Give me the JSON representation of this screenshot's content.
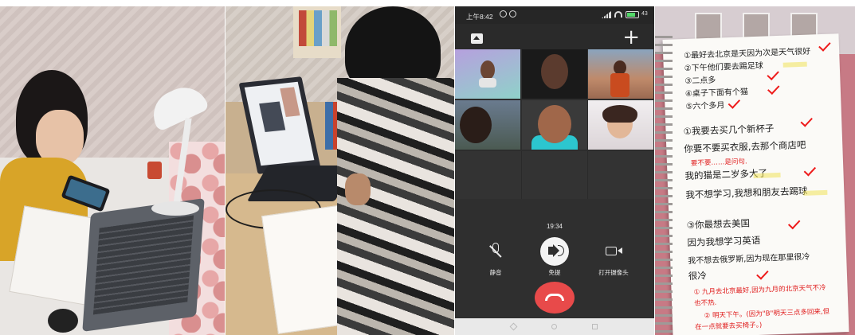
{
  "video_call": {
    "status_bar": {
      "time": "上午8:42",
      "battery": "43"
    },
    "add_label": "+",
    "duration": "19:34",
    "controls": {
      "mute_label": "静音",
      "speaker_label": "免提",
      "camera_label": "打开摄像头"
    },
    "participant_count": 6
  },
  "notebook": {
    "lines": [
      "①最好去北京是天因为次是天气很好",
      "②下午他们要去踢足球",
      "③二点多",
      "④桌子下面有个猫",
      "⑤六个多月",
      "①我要去买几个新杯子",
      "你要不要买衣服,去那个商店吧",
      "我的猫是二岁多大了",
      "我不想学习,我想和朋友去踢球",
      "③你最想去美国",
      "因为我想学习英语",
      "我不想去俄罗斯,因为现在那里很冷",
      "很冷"
    ],
    "corrections": [
      "要不要……是问句.",
      "① 九月去北京最好,因为九月的北京天气不冷",
      "也不热.",
      "② 明天下午。(因为\"B\"明天三点多回来,但",
      "在一点就要去买椅子。)"
    ],
    "check_color": "#ee1b1b"
  },
  "colors": {
    "call_background": "#2d2d2d",
    "hangup": "#e84a4a",
    "ink_red": "#e01c1c"
  }
}
